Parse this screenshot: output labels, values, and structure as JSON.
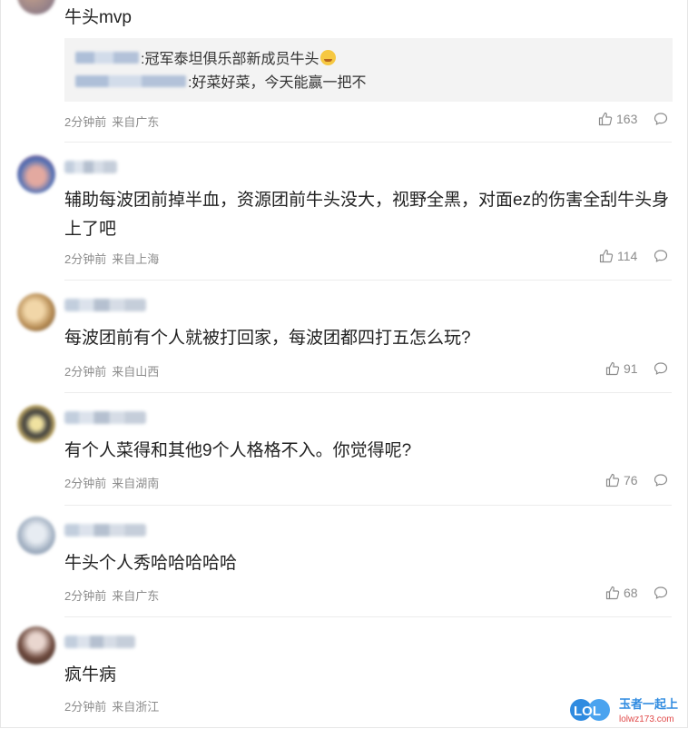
{
  "comments": [
    {
      "text": "牛头mvp",
      "quote": [
        {
          "text": ":冠军泰坦俱乐部新成员牛头",
          "emoji": "laughing-crying-icon"
        },
        {
          "text": ":好菜好菜，今天能赢一把不"
        }
      ],
      "time": "2分钟前",
      "location": "来自广东",
      "likes": "163"
    },
    {
      "text": "辅助每波团前掉半血，资源团前牛头没大，视野全黑，对面ez的伤害全刮牛头身上了吧",
      "time": "2分钟前",
      "location": "来自上海",
      "likes": "114"
    },
    {
      "text": "每波团前有个人就被打回家，每波团都四打五怎么玩?",
      "time": "2分钟前",
      "location": "来自山西",
      "likes": "91"
    },
    {
      "text": "有个人菜得和其他9个人格格不入。你觉得呢?",
      "time": "2分钟前",
      "location": "来自湖南",
      "likes": "76"
    },
    {
      "text": "牛头个人秀哈哈哈哈哈",
      "time": "2分钟前",
      "location": "来自广东",
      "likes": "68"
    },
    {
      "text": "疯牛病",
      "time": "2分钟前",
      "location": "来自浙江",
      "likes": ""
    }
  ],
  "watermark": {
    "brand": "LOL",
    "cn": "玉者一起上",
    "url": "lolwz173.com"
  },
  "colors": {
    "accent": "#2f8be0",
    "muted": "#8c8c8c"
  }
}
